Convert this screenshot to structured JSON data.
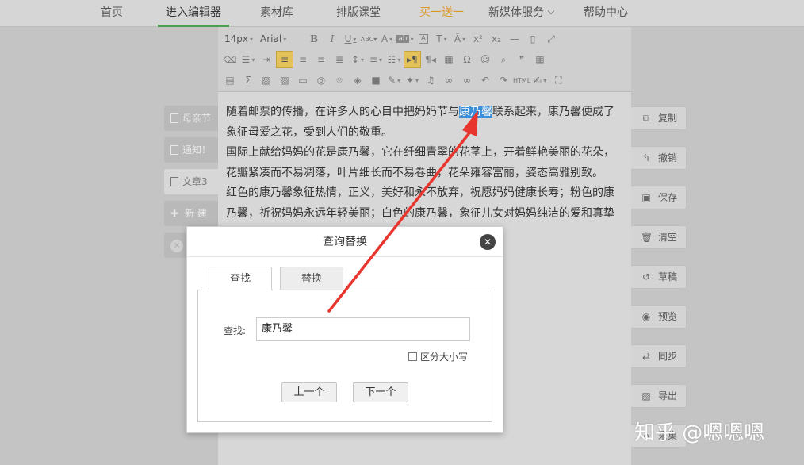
{
  "nav": {
    "home": "首页",
    "editor": "进入编辑器",
    "materials": "素材库",
    "course": "排版课堂",
    "promo": "买一送一",
    "media": "新媒体服务",
    "help": "帮助中心"
  },
  "toolbar": {
    "font_size": "14px",
    "font_family": "Arial"
  },
  "content": {
    "line1_a": "随着邮票的传播，在许多人的心目中把妈妈节与",
    "line1_hl": "康乃馨",
    "line1_b": "联系起来，康乃馨便成了",
    "line2": "象征母爱之花，受到人们的敬重。",
    "line3": "国际上献给妈妈的花是康乃馨，它在纤细青翠的花茎上，开着鲜艳美丽的花朵，",
    "line4": "花瓣紧凑而不易凋落，叶片细长而不易卷曲，花朵雍容富丽，姿态高雅别致。",
    "line5": "红色的康乃馨象征热情，正义，美好和永不放弃，祝愿妈妈健康长寿；粉色的康",
    "line6": "乃馨，祈祝妈妈永远年轻美丽；白色的康乃馨，象征儿女对妈妈纯洁的爱和真挚"
  },
  "docs": {
    "item1": "母亲节",
    "item2": "通知！",
    "item3": "文章3",
    "new": "新 建"
  },
  "actions": {
    "copy": "复制",
    "undo": "撤销",
    "save": "保存",
    "clear": "清空",
    "draft": "草稿",
    "preview": "预览",
    "sync": "同步",
    "export": "导出",
    "collect": "采集"
  },
  "dialog": {
    "title": "查询替换",
    "tab_find": "查找",
    "tab_replace": "替换",
    "find_label": "查找:",
    "find_value": "康乃馨",
    "case_label": "区分大小写",
    "prev": "上一个",
    "next": "下一个"
  },
  "watermark": "知乎 @嗯嗯嗯",
  "colors": {
    "nav_active_underline": "#49a14f",
    "promo": "#d99a2a",
    "selection": "#3d8ed8",
    "arrow": "#e8352e"
  }
}
